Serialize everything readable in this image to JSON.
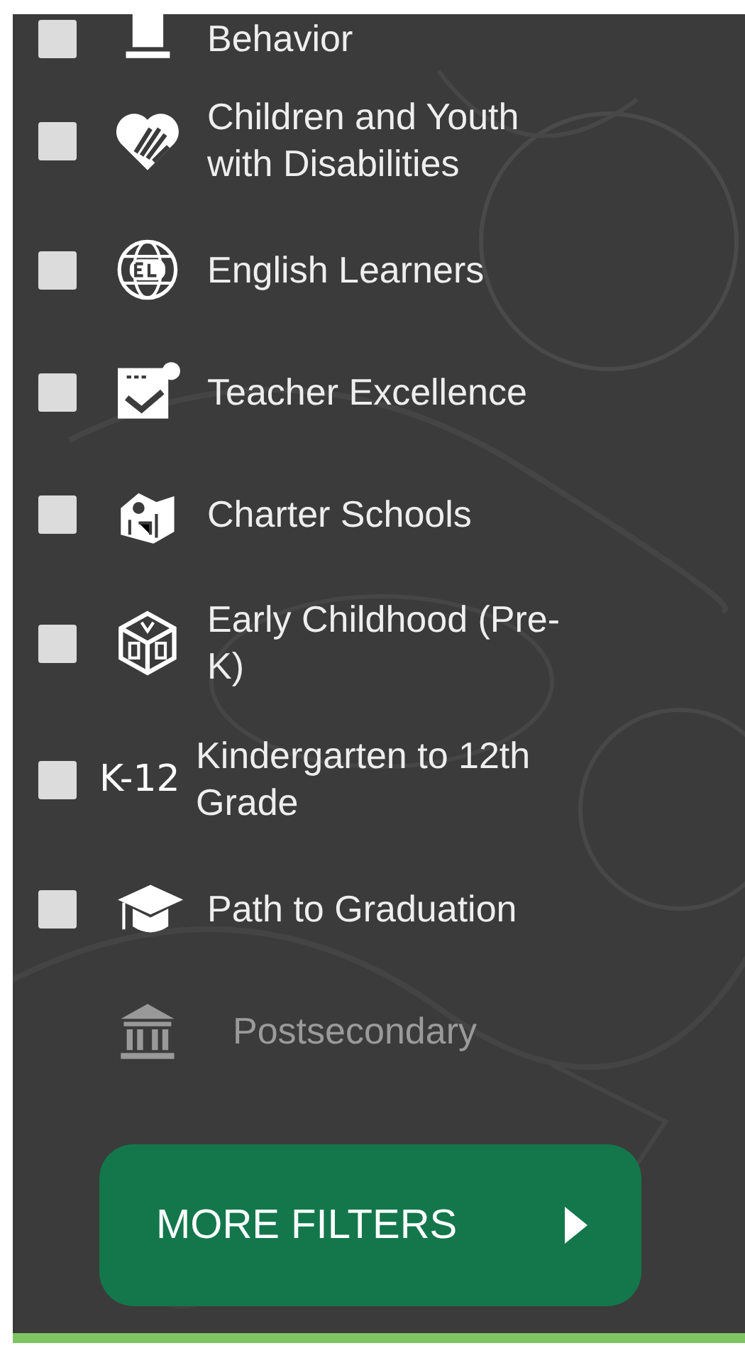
{
  "filters": [
    {
      "label": "Behavior",
      "checked": false,
      "disabled": false
    },
    {
      "label": "Children and Youth with Disabilities",
      "checked": false,
      "disabled": false
    },
    {
      "label": "English Learners",
      "checked": false,
      "disabled": false
    },
    {
      "label": "Teacher Excellence",
      "checked": false,
      "disabled": false
    },
    {
      "label": "Charter Schools",
      "checked": false,
      "disabled": false
    },
    {
      "label": "Early Childhood (Pre-K)",
      "checked": false,
      "disabled": false
    },
    {
      "label": "Kindergarten to 12th Grade",
      "icon_text": "K-12",
      "checked": false,
      "disabled": false
    },
    {
      "label": "Path to Graduation",
      "checked": false,
      "disabled": false
    },
    {
      "label": "Postsecondary",
      "disabled": true
    }
  ],
  "more_button": {
    "label": "MORE FILTERS"
  }
}
